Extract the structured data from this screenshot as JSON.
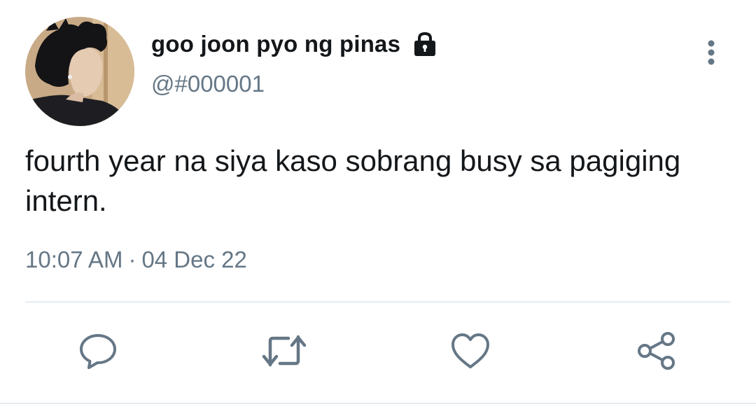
{
  "tweet": {
    "author": {
      "display_name": "goo joon pyo ng pinas",
      "handle": "@#000001",
      "protected_icon": "lock-icon",
      "avatar": "profile-photo"
    },
    "text": "fourth year na siya kaso sobrang busy sa pagiging intern.",
    "time": "10:07 AM",
    "separator": "·",
    "date": "04 Dec 22",
    "more_icon": "more-vertical-icon"
  },
  "actions": [
    {
      "name": "reply",
      "icon": "reply-icon"
    },
    {
      "name": "retweet",
      "icon": "retweet-icon"
    },
    {
      "name": "like",
      "icon": "heart-icon"
    },
    {
      "name": "share",
      "icon": "share-icon"
    }
  ],
  "colors": {
    "text_primary": "#14171a",
    "text_secondary": "#657786",
    "divider": "#e6ecf0",
    "icon": "#657786"
  }
}
